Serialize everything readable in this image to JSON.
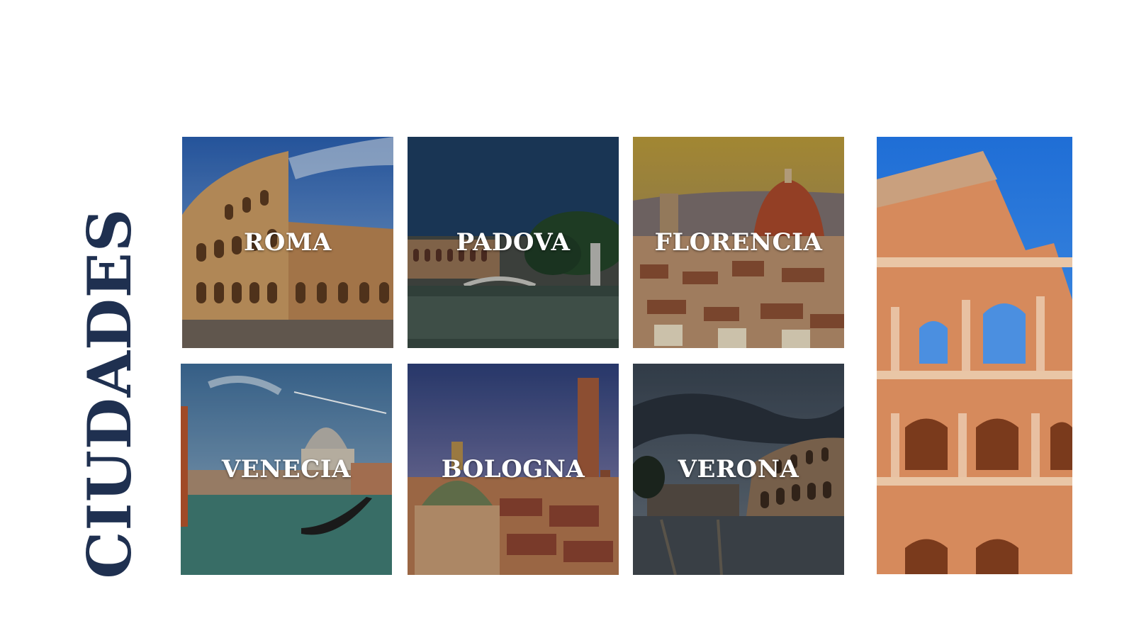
{
  "title": "CIUDADES",
  "cities": [
    {
      "name": "ROMA",
      "icon": "colosseum-photo"
    },
    {
      "name": "PADOVA",
      "icon": "prato-della-valle-photo"
    },
    {
      "name": "FLORENCIA",
      "icon": "florence-duomo-photo"
    },
    {
      "name": "VENECIA",
      "icon": "venice-gondola-photo"
    },
    {
      "name": "BOLOGNA",
      "icon": "bologna-towers-photo"
    },
    {
      "name": "VERONA",
      "icon": "verona-arena-photo"
    }
  ],
  "hero": {
    "icon": "colosseum-closeup-photo"
  },
  "colors": {
    "title": "#1f3050",
    "label": "#ffffff"
  }
}
